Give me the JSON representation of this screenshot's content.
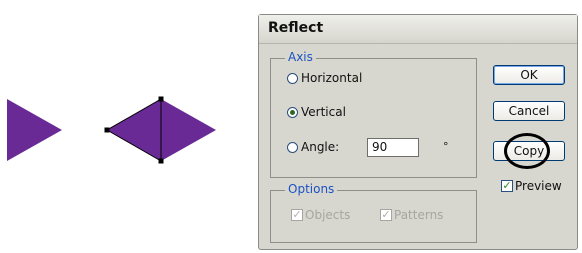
{
  "dialog": {
    "title": "Reflect",
    "axis": {
      "legend": "Axis",
      "horizontal_label": "Horizontal",
      "vertical_label": "Vertical",
      "angle_label": "Angle:",
      "angle_value": "90",
      "degree_symbol": "°",
      "selected": "vertical"
    },
    "options": {
      "legend": "Options",
      "objects_label": "Objects",
      "patterns_label": "Patterns",
      "objects_checked": true,
      "patterns_checked": true,
      "enabled": false
    },
    "buttons": {
      "ok": "OK",
      "cancel": "Cancel",
      "copy": "Copy"
    },
    "preview": {
      "label": "Preview",
      "checked": true
    }
  },
  "colors": {
    "shape_fill": "#6a2a96",
    "dialog_bg": "#d8d7cf",
    "group_legend": "#1a52c4"
  },
  "icons": {
    "original_shape": "right-pointing-triangle",
    "reflected_shape": "diamond-with-bounding-points",
    "check": "checkmark"
  }
}
